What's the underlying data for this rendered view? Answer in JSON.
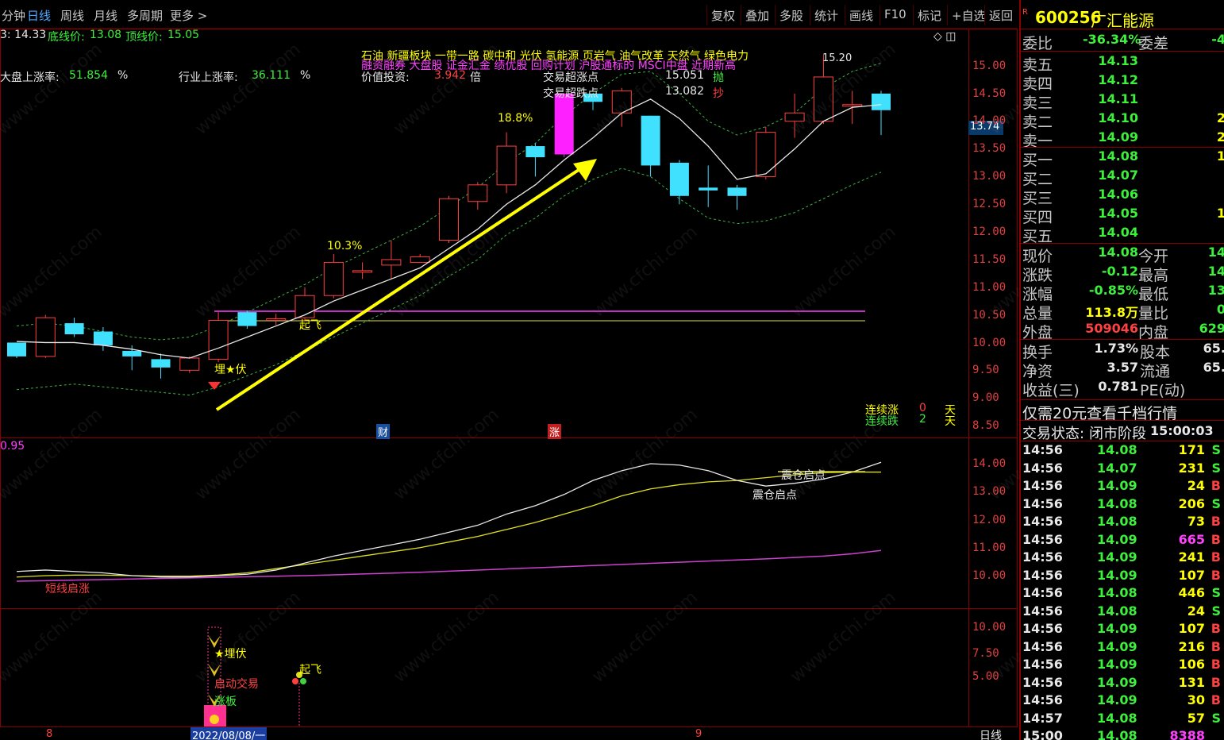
{
  "toolbar": {
    "tabs": [
      "分钟",
      "日线",
      "周线",
      "月线",
      "多周期",
      "更多 >"
    ],
    "active_tab": "日线",
    "buttons": [
      "复权",
      "叠加",
      "多股",
      "统计",
      "画线",
      "F10",
      "标记",
      "+自选",
      "返回"
    ]
  },
  "info_line": {
    "left_val": "3: 14.33",
    "bottom_label": "底线价:",
    "bottom_val": "13.08",
    "top_label": "顶线价:",
    "top_val": "15.05"
  },
  "stats": {
    "market_label": "大盘上涨率:",
    "market_val": "51.854",
    "market_unit": "%",
    "industry_label": "行业上涨率:",
    "industry_val": "36.111",
    "industry_unit": "%",
    "value_label": "价值投资:",
    "value_val": "3.942",
    "value_unit": "倍",
    "buy_label": "交易超涨点",
    "buy_val": "15.051",
    "buy_action": "抛",
    "sell_label": "交易超跌点",
    "sell_val": "13.082",
    "sell_action": "抄"
  },
  "concepts_line1": "石油 新疆板块 一带一路 碳中和 光伏 氢能源 页岩气 油气改革 天然气 绿色电力",
  "concepts_line2": "融资融券 大盘股 证金汇金 绩优股 回购计划 沪股通标的 MSCI中盘 近期新高",
  "chart_labels": {
    "pct1": "18.8%",
    "pct2": "10.3%",
    "peak_price": "15.20",
    "qifei": "起飞",
    "maifu": "埋★伏",
    "cai": "财",
    "zhang": "涨",
    "cont_up_label": "连续涨",
    "cont_up_val": "0",
    "cont_up_unit": "天",
    "cont_down_label": "连续跌",
    "cont_down_val": "2",
    "cont_down_unit": "天",
    "current_price_box": "13.74"
  },
  "main_axis": [
    "15.00",
    "14.50",
    "14.00",
    "13.50",
    "13.00",
    "12.50",
    "12.00",
    "11.50",
    "11.00",
    "10.50",
    "10.00",
    "9.50",
    "9.00",
    "8.50"
  ],
  "mid_panel": {
    "value": "0.95",
    "label1": "震仓启点",
    "label2": "震仓启点",
    "label3": "短线启涨",
    "axis": [
      "14.00",
      "13.00",
      "12.00",
      "11.00",
      "10.00"
    ]
  },
  "bottom_panel": {
    "label_maifu": "★埋伏",
    "label_qidong": "启动交易",
    "label_zhangting": "涨板",
    "label_qifei": "起飞",
    "axis": [
      "10.00",
      "7.50",
      "5.00"
    ]
  },
  "x_axis": {
    "month1": "8",
    "date_box": "2022/08/08/一",
    "month2": "9",
    "period": "日线"
  },
  "stock": {
    "code": "600256",
    "name": "广汇能源",
    "badge": "R",
    "weibi_label": "委比",
    "weibi_val": "-36.34%",
    "weicha_label": "委差",
    "weicha_val": "-4",
    "asks": [
      {
        "label": "卖五",
        "price": "14.13",
        "vol": ""
      },
      {
        "label": "卖四",
        "price": "14.12",
        "vol": ""
      },
      {
        "label": "卖三",
        "price": "14.11",
        "vol": ""
      },
      {
        "label": "卖二",
        "price": "14.10",
        "vol": "2"
      },
      {
        "label": "卖一",
        "price": "14.09",
        "vol": "2"
      }
    ],
    "bids": [
      {
        "label": "买一",
        "price": "14.08",
        "vol": "1"
      },
      {
        "label": "买二",
        "price": "14.07",
        "vol": ""
      },
      {
        "label": "买三",
        "price": "14.06",
        "vol": ""
      },
      {
        "label": "买四",
        "price": "14.05",
        "vol": "1"
      },
      {
        "label": "买五",
        "price": "14.04",
        "vol": ""
      }
    ],
    "quote": [
      {
        "l1": "现价",
        "v1": "14.08",
        "c1": "g",
        "l2": "今开",
        "v2": "14"
      },
      {
        "l1": "涨跌",
        "v1": "-0.12",
        "c1": "g",
        "l2": "最高",
        "v2": "14"
      },
      {
        "l1": "涨幅",
        "v1": "-0.85%",
        "c1": "g",
        "l2": "最低",
        "v2": "13"
      },
      {
        "l1": "总量",
        "v1": "113.8万",
        "c1": "y",
        "l2": "量比",
        "v2": "0"
      },
      {
        "l1": "外盘",
        "v1": "509046",
        "c1": "r",
        "l2": "内盘",
        "v2": "629"
      }
    ],
    "fund": [
      {
        "l1": "换手",
        "v1": "1.73%",
        "l2": "股本",
        "v2": "65."
      },
      {
        "l1": "净资",
        "v1": "3.57",
        "l2": "流通",
        "v2": "65."
      },
      {
        "l1": "收益(三)",
        "v1": "0.781",
        "l2": "PE(动)",
        "v2": ""
      }
    ],
    "promo": "仅需20元查看千档行情",
    "status_label": "交易状态:",
    "status_val": "闭市阶段",
    "status_time": "15:00:03",
    "ticks": [
      {
        "t": "14:56",
        "p": "14.08",
        "v": "171",
        "s": "S"
      },
      {
        "t": "14:56",
        "p": "14.07",
        "v": "231",
        "s": "S"
      },
      {
        "t": "14:56",
        "p": "14.09",
        "v": "24",
        "s": "B"
      },
      {
        "t": "14:56",
        "p": "14.08",
        "v": "206",
        "s": "S"
      },
      {
        "t": "14:56",
        "p": "14.08",
        "v": "73",
        "s": "B"
      },
      {
        "t": "14:56",
        "p": "14.09",
        "v": "665",
        "s": "B"
      },
      {
        "t": "14:56",
        "p": "14.09",
        "v": "241",
        "s": "B"
      },
      {
        "t": "14:56",
        "p": "14.09",
        "v": "107",
        "s": "B"
      },
      {
        "t": "14:56",
        "p": "14.08",
        "v": "446",
        "s": "S"
      },
      {
        "t": "14:56",
        "p": "14.08",
        "v": "24",
        "s": "S"
      },
      {
        "t": "14:56",
        "p": "14.09",
        "v": "107",
        "s": "B"
      },
      {
        "t": "14:56",
        "p": "14.09",
        "v": "216",
        "s": "B"
      },
      {
        "t": "14:56",
        "p": "14.09",
        "v": "106",
        "s": "B"
      },
      {
        "t": "14:56",
        "p": "14.09",
        "v": "131",
        "s": "B"
      },
      {
        "t": "14:56",
        "p": "14.09",
        "v": "30",
        "s": "B"
      },
      {
        "t": "14:57",
        "p": "14.08",
        "v": "57",
        "s": "S"
      },
      {
        "t": "15:00",
        "p": "14.08",
        "v": "8388",
        "s": ""
      }
    ]
  },
  "colors": {
    "up": "#ff4040",
    "down": "#40e0ff",
    "ma": "#e8e8e8",
    "band": "#3cb043",
    "arrow": "#ffff00",
    "purple": "#c030c0"
  },
  "candles": [
    {
      "o": 10.0,
      "c": 9.75,
      "h": 10.0,
      "l": 9.72
    },
    {
      "o": 9.75,
      "c": 10.45,
      "h": 10.5,
      "l": 9.72
    },
    {
      "o": 10.35,
      "c": 10.15,
      "h": 10.45,
      "l": 10.1
    },
    {
      "o": 10.2,
      "c": 9.95,
      "h": 10.28,
      "l": 9.85
    },
    {
      "o": 9.85,
      "c": 9.75,
      "h": 9.95,
      "l": 9.5
    },
    {
      "o": 9.7,
      "c": 9.55,
      "h": 9.8,
      "l": 9.35
    },
    {
      "o": 9.5,
      "c": 9.72,
      "h": 9.75,
      "l": 9.45
    },
    {
      "o": 9.7,
      "c": 10.4,
      "h": 10.55,
      "l": 9.65
    },
    {
      "o": 10.55,
      "c": 10.3,
      "h": 10.58,
      "l": 10.25
    },
    {
      "o": 10.42,
      "c": 10.43,
      "h": 10.52,
      "l": 10.32
    },
    {
      "o": 10.45,
      "c": 10.85,
      "h": 11.0,
      "l": 10.4
    },
    {
      "o": 10.85,
      "c": 11.45,
      "h": 11.6,
      "l": 10.8
    },
    {
      "o": 11.3,
      "c": 11.3,
      "h": 11.45,
      "l": 11.15
    },
    {
      "o": 11.4,
      "c": 11.5,
      "h": 11.85,
      "l": 11.15
    },
    {
      "o": 11.45,
      "c": 11.55,
      "h": 11.6,
      "l": 11.45
    },
    {
      "o": 11.85,
      "c": 12.6,
      "h": 12.65,
      "l": 11.8
    },
    {
      "o": 12.55,
      "c": 12.85,
      "h": 12.9,
      "l": 12.4
    },
    {
      "o": 12.85,
      "c": 13.55,
      "h": 13.8,
      "l": 12.7
    },
    {
      "o": 13.55,
      "c": 13.35,
      "h": 13.6,
      "l": 13.0
    },
    {
      "o": 13.4,
      "c": 14.5,
      "h": 14.5,
      "l": 13.35,
      "limit": true
    },
    {
      "o": 14.5,
      "c": 14.35,
      "h": 14.5,
      "l": 14.2
    },
    {
      "o": 14.15,
      "c": 14.55,
      "h": 14.6,
      "l": 13.9
    },
    {
      "o": 14.1,
      "c": 13.2,
      "h": 14.1,
      "l": 13.0
    },
    {
      "o": 13.25,
      "c": 12.65,
      "h": 13.3,
      "l": 12.5
    },
    {
      "o": 12.8,
      "c": 12.75,
      "h": 13.2,
      "l": 12.45
    },
    {
      "o": 12.8,
      "c": 12.65,
      "h": 12.85,
      "l": 12.4
    },
    {
      "o": 13.0,
      "c": 13.8,
      "h": 13.9,
      "l": 12.95
    },
    {
      "o": 14.0,
      "c": 14.15,
      "h": 14.5,
      "l": 13.7
    },
    {
      "o": 14.0,
      "c": 14.8,
      "h": 15.2,
      "l": 13.95
    },
    {
      "o": 14.3,
      "c": 14.3,
      "h": 14.55,
      "l": 13.95
    },
    {
      "o": 14.5,
      "c": 14.2,
      "h": 14.55,
      "l": 13.75
    }
  ],
  "ma": [
    10.02,
    10.0,
    10.0,
    9.95,
    9.88,
    9.78,
    9.72,
    9.9,
    10.1,
    10.3,
    10.5,
    10.75,
    10.95,
    11.15,
    11.35,
    11.7,
    12.05,
    12.5,
    12.85,
    13.3,
    13.7,
    14.15,
    14.4,
    14.05,
    13.55,
    12.95,
    13.05,
    13.5,
    14.0,
    14.25,
    14.3
  ],
  "band_top": [
    10.3,
    10.35,
    10.3,
    10.2,
    10.1,
    10.05,
    10.1,
    10.3,
    10.55,
    10.8,
    11.05,
    11.35,
    11.6,
    11.85,
    12.1,
    12.45,
    12.8,
    13.25,
    13.6,
    14.1,
    14.5,
    14.85,
    14.9,
    14.5,
    14.0,
    13.75,
    13.9,
    14.15,
    14.6,
    14.9,
    15.05
  ],
  "band_bot": [
    9.15,
    9.2,
    9.25,
    9.2,
    9.15,
    9.1,
    9.05,
    9.2,
    9.4,
    9.6,
    9.85,
    10.1,
    10.35,
    10.6,
    10.85,
    11.2,
    11.5,
    11.95,
    12.25,
    12.65,
    12.95,
    13.15,
    13.0,
    12.6,
    12.25,
    12.15,
    12.2,
    12.35,
    12.6,
    12.85,
    13.08
  ],
  "mid_white": [
    10.15,
    10.2,
    10.15,
    10.1,
    10.0,
    9.95,
    9.95,
    10.0,
    10.05,
    10.2,
    10.45,
    10.7,
    10.9,
    11.1,
    11.3,
    11.55,
    11.8,
    12.2,
    12.5,
    12.9,
    13.4,
    13.75,
    14.0,
    13.95,
    13.75,
    13.4,
    13.2,
    13.3,
    13.45,
    13.7,
    14.05
  ],
  "mid_yellow": [
    9.95,
    10.0,
    10.02,
    10.02,
    10.0,
    9.98,
    9.98,
    10.02,
    10.1,
    10.25,
    10.4,
    10.55,
    10.7,
    10.85,
    11.0,
    11.2,
    11.4,
    11.65,
    11.9,
    12.2,
    12.5,
    12.85,
    13.1,
    13.25,
    13.35,
    13.4,
    13.5,
    13.6,
    13.68,
    13.7,
    13.7
  ],
  "mid_purple": [
    9.8,
    9.82,
    9.84,
    9.86,
    9.88,
    9.9,
    9.92,
    9.94,
    9.96,
    9.98,
    10.0,
    10.03,
    10.06,
    10.09,
    10.12,
    10.16,
    10.2,
    10.24,
    10.28,
    10.32,
    10.36,
    10.4,
    10.44,
    10.48,
    10.52,
    10.56,
    10.6,
    10.65,
    10.7,
    10.78,
    10.9
  ]
}
